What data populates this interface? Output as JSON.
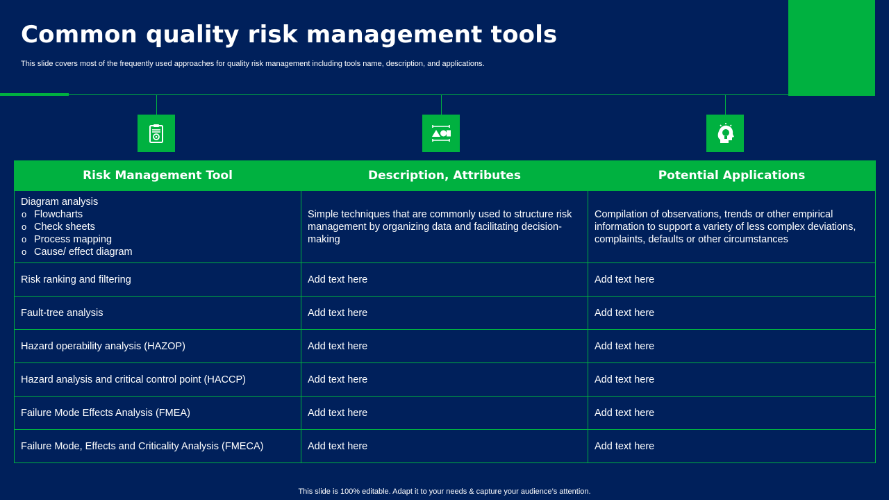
{
  "header": {
    "title": "Common quality risk management tools",
    "subtitle": "This slide covers most of the frequently used approaches for quality risk management including tools name, description, and applications."
  },
  "icons": [
    "clipboard-gear-icon",
    "shapes-icon",
    "head-lightbulb-icon"
  ],
  "colors": {
    "background": "#00205b",
    "accent": "#00b140",
    "text": "#ffffff"
  },
  "table": {
    "headers": [
      "Risk Management Tool",
      "Description, Attributes",
      "Potential Applications"
    ],
    "first_row": {
      "tool_title": "Diagram analysis",
      "tool_items": [
        "Flowcharts",
        "Check sheets",
        "Process mapping",
        "Cause/ effect diagram"
      ],
      "description": "Simple techniques that are commonly used to structure risk management by organizing data and facilitating decision-making",
      "applications": "Compilation of observations, trends or other empirical information to support a variety of less complex deviations, complaints, defaults or other circumstances"
    },
    "rows": [
      {
        "tool": "Risk ranking and filtering",
        "description": "Add text here",
        "applications": "Add text here"
      },
      {
        "tool": "Fault-tree analysis",
        "description": "Add text here",
        "applications": "Add text here"
      },
      {
        "tool": "Hazard operability analysis (HAZOP)",
        "description": "Add text here",
        "applications": "Add text here"
      },
      {
        "tool": "Hazard analysis and critical control point (HACCP)",
        "description": "Add text here",
        "applications": "Add text here"
      },
      {
        "tool": "Failure Mode Effects Analysis (FMEA)",
        "description": "Add text here",
        "applications": "Add text here"
      },
      {
        "tool": "Failure Mode, Effects and Criticality Analysis (FMECA)",
        "description": "Add text here",
        "applications": "Add text here"
      }
    ]
  },
  "footer": "This slide is 100% editable. Adapt it to your needs & capture your audience’s attention."
}
